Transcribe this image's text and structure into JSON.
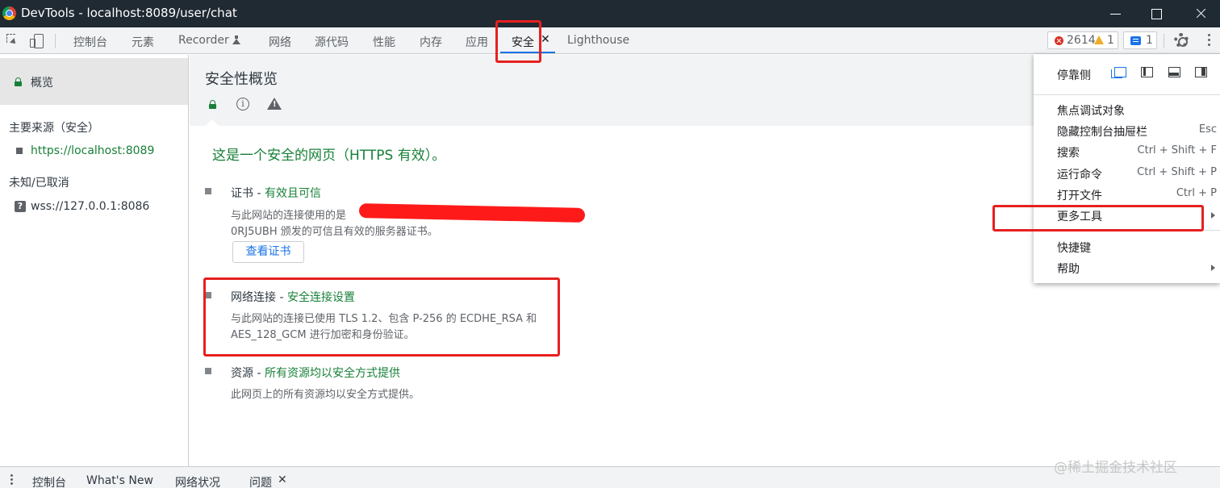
{
  "window": {
    "title": "DevTools - localhost:8089/user/chat"
  },
  "tabs": {
    "console": "控制台",
    "elements": "元素",
    "recorder": "Recorder",
    "network": "网络",
    "sources": "源代码",
    "performance": "性能",
    "memory": "内存",
    "application": "应用",
    "security": "安全",
    "lighthouse": "Lighthouse",
    "close_glyph": "✕"
  },
  "counters": {
    "errors": "2614",
    "warnings": "1",
    "messages": "1"
  },
  "sidebar": {
    "overview": "概览",
    "main_origin_heading": "主要来源（安全）",
    "main_origin": "https://localhost:8089",
    "unknown_heading": "未知/已取消",
    "unknown_origin": "wss://127.0.0.1:8086",
    "unknown_glyph": "?"
  },
  "main": {
    "title": "安全性概览",
    "info_glyph": "i",
    "summary": "这是一个安全的网页（HTTPS 有效）。",
    "certificate": {
      "label": "证书 - ",
      "status": "有效且可信",
      "desc_line1": "与此网站的连接使用的是",
      "desc_line2": "0RJ5UBH 颁发的可信且有效的服务器证书。",
      "button": "查看证书"
    },
    "connection": {
      "label": "网络连接 - ",
      "status": "安全连接设置",
      "desc": "与此网站的连接已使用 TLS 1.2、包含 P-256 的 ECDHE_RSA 和 AES_128_GCM 进行加密和身份验证。"
    },
    "resources": {
      "label": "资源 - ",
      "status": "所有资源均以安全方式提供",
      "desc": "此网页上的所有资源均以安全方式提供。"
    }
  },
  "menu": {
    "dock_side": "停靠侧",
    "items": [
      {
        "label": "焦点调试对象",
        "shortcut": ""
      },
      {
        "label": "隐藏控制台抽屉栏",
        "shortcut": "Esc"
      },
      {
        "label": "搜索",
        "shortcut": "Ctrl + Shift + F"
      },
      {
        "label": "运行命令",
        "shortcut": "Ctrl + Shift + P"
      },
      {
        "label": "打开文件",
        "shortcut": "Ctrl + P"
      },
      {
        "label": "更多工具",
        "shortcut": ""
      },
      {
        "label": "快捷键",
        "shortcut": ""
      },
      {
        "label": "帮助",
        "shortcut": ""
      }
    ]
  },
  "drawer": {
    "console": "控制台",
    "whats_new": "What's New",
    "network_conditions": "网络状况",
    "issues": "问题",
    "close_glyph": "✕"
  },
  "watermark": "@稀土掘金技术社区",
  "colors": {
    "accent": "#1a73e8",
    "secure": "#188038",
    "annotation": "#e6201f"
  }
}
